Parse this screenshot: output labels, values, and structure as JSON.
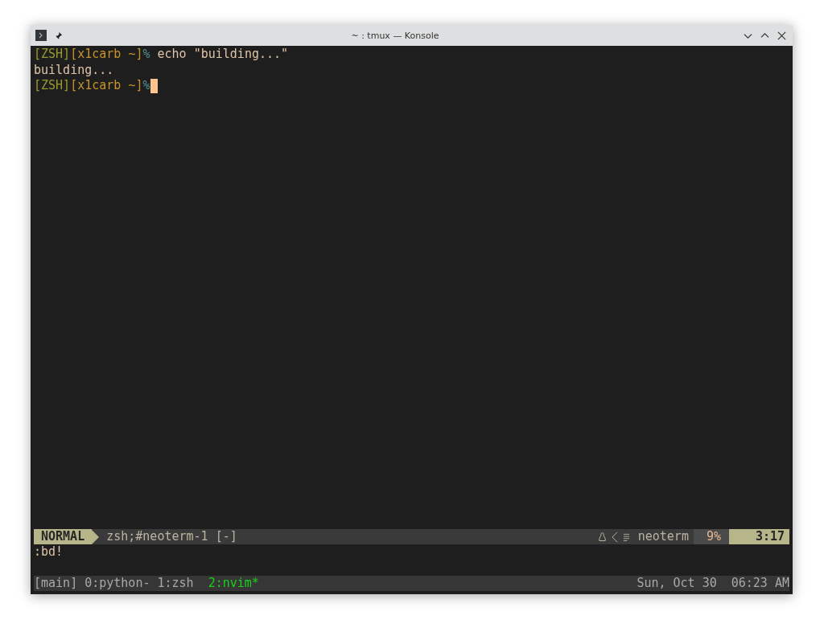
{
  "window": {
    "title": "~ : tmux — Konsole"
  },
  "terminal": {
    "lines": [
      {
        "segments": [
          {
            "kind": "tag",
            "text": "[ZSH]"
          },
          {
            "kind": "host",
            "text": "[x1carb ~]"
          },
          {
            "kind": "symbol",
            "text": "%"
          },
          {
            "kind": "text",
            "text": " echo \"building...\""
          }
        ],
        "cursor": false
      },
      {
        "segments": [
          {
            "kind": "text",
            "text": "building..."
          }
        ],
        "cursor": false
      },
      {
        "segments": [
          {
            "kind": "tag",
            "text": "[ZSH]"
          },
          {
            "kind": "host",
            "text": "[x1carb ~]"
          },
          {
            "kind": "symbol",
            "text": "%"
          }
        ],
        "cursor": true
      }
    ]
  },
  "vim_status": {
    "mode": "NORMAL",
    "file": "zsh;#neoterm-1 [-]",
    "filetype": "neoterm",
    "percent": "9%",
    "position": "3:17"
  },
  "command_line": ":bd!",
  "tmux_bar": {
    "session": "[main]",
    "windows": [
      {
        "label": "0:python-",
        "selected": false
      },
      {
        "label": "1:zsh",
        "selected": false
      },
      {
        "label": "2:nvim*",
        "selected": true
      }
    ],
    "date": "Sun, Oct 30",
    "time": "06:23 AM"
  }
}
